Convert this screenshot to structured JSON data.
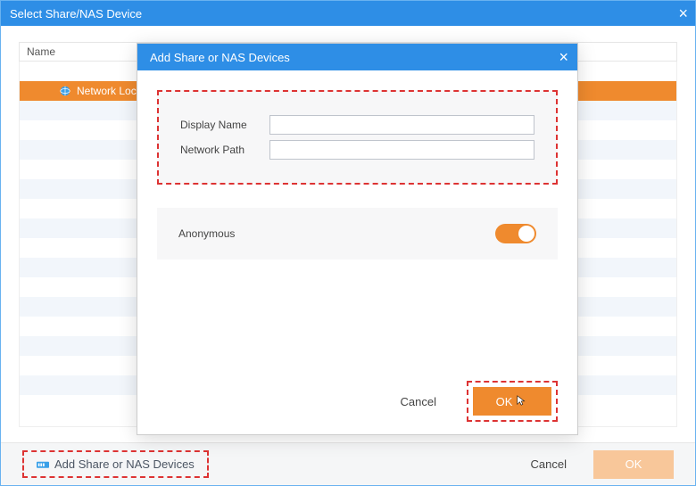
{
  "outer": {
    "title": "Select Share/NAS Device",
    "tree": {
      "name_header": "Name",
      "item_label": "Network Loc"
    },
    "footer": {
      "add_link": "Add Share or NAS Devices",
      "cancel": "Cancel",
      "ok": "OK"
    }
  },
  "modal": {
    "title": "Add Share or NAS Devices",
    "display_name_label": "Display Name",
    "display_name_value": "",
    "network_path_label": "Network Path",
    "network_path_value": "",
    "anonymous_label": "Anonymous",
    "anonymous_on": true,
    "cancel": "Cancel",
    "ok": "OK"
  },
  "colors": {
    "accent_blue": "#2e8ee6",
    "accent_orange": "#ef8a2e",
    "highlight_border": "#d33"
  }
}
